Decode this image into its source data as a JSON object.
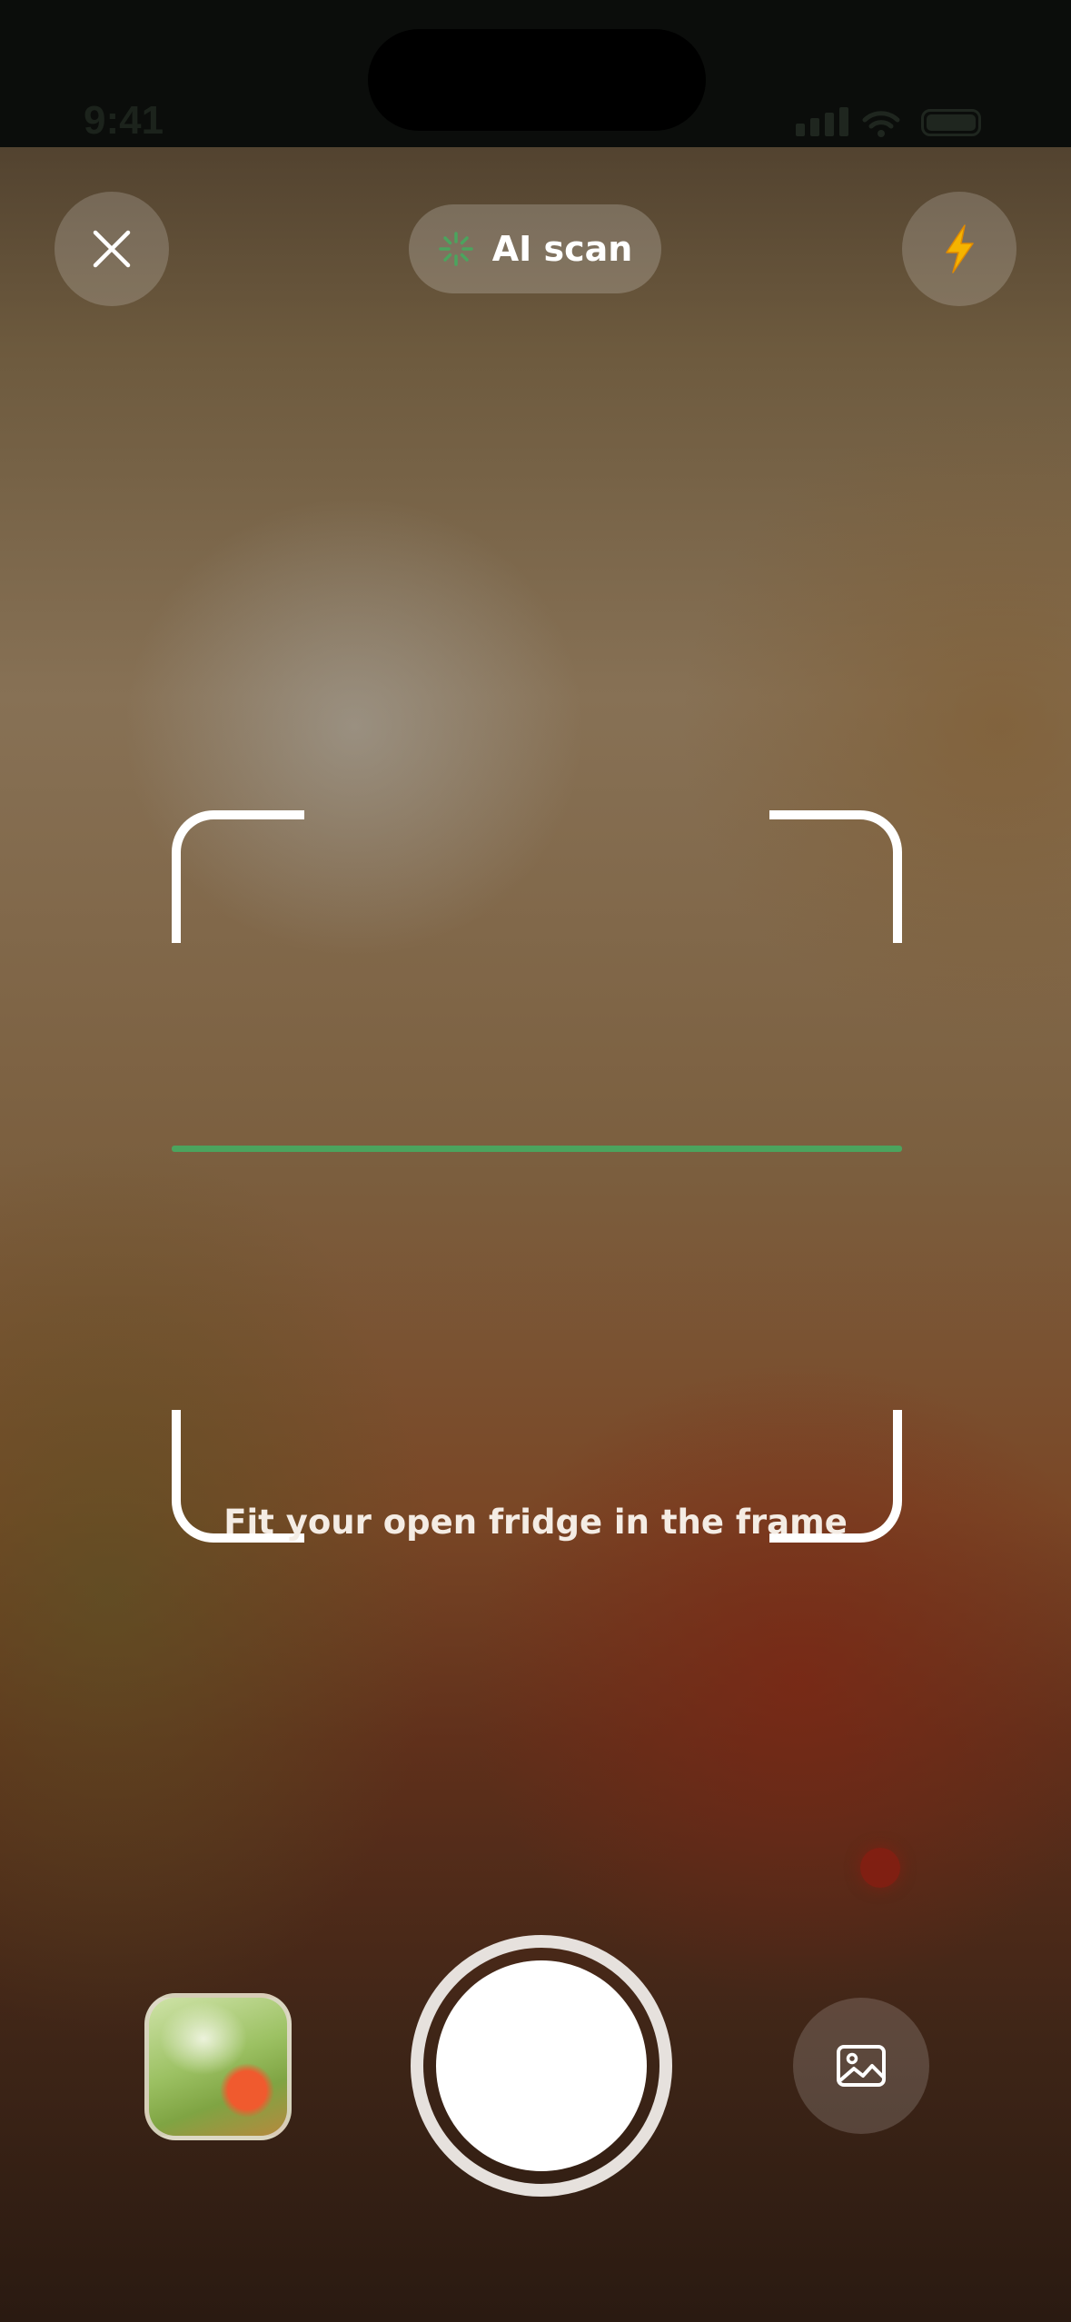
{
  "status_bar": {
    "time": "9:41"
  },
  "top_bar": {
    "close_icon": "close-icon",
    "mode_label": "AI scan",
    "mode_icon": "sparkle-spinner-icon",
    "flash_icon": "lightning-bolt-icon"
  },
  "viewfinder": {
    "hint": "Fit your open fridge in the frame",
    "scan_line_color": "#4ba45e",
    "frame_color": "#ffffff"
  },
  "bottom_bar": {
    "thumbnail_icon": "last-photo-thumbnail",
    "shutter_icon": "shutter-button",
    "gallery_icon": "image-gallery-icon"
  },
  "colors": {
    "accent_green": "#4ba45e",
    "flash_yellow": "#f5b400",
    "thumbnail_dot": "#f05a2e"
  }
}
